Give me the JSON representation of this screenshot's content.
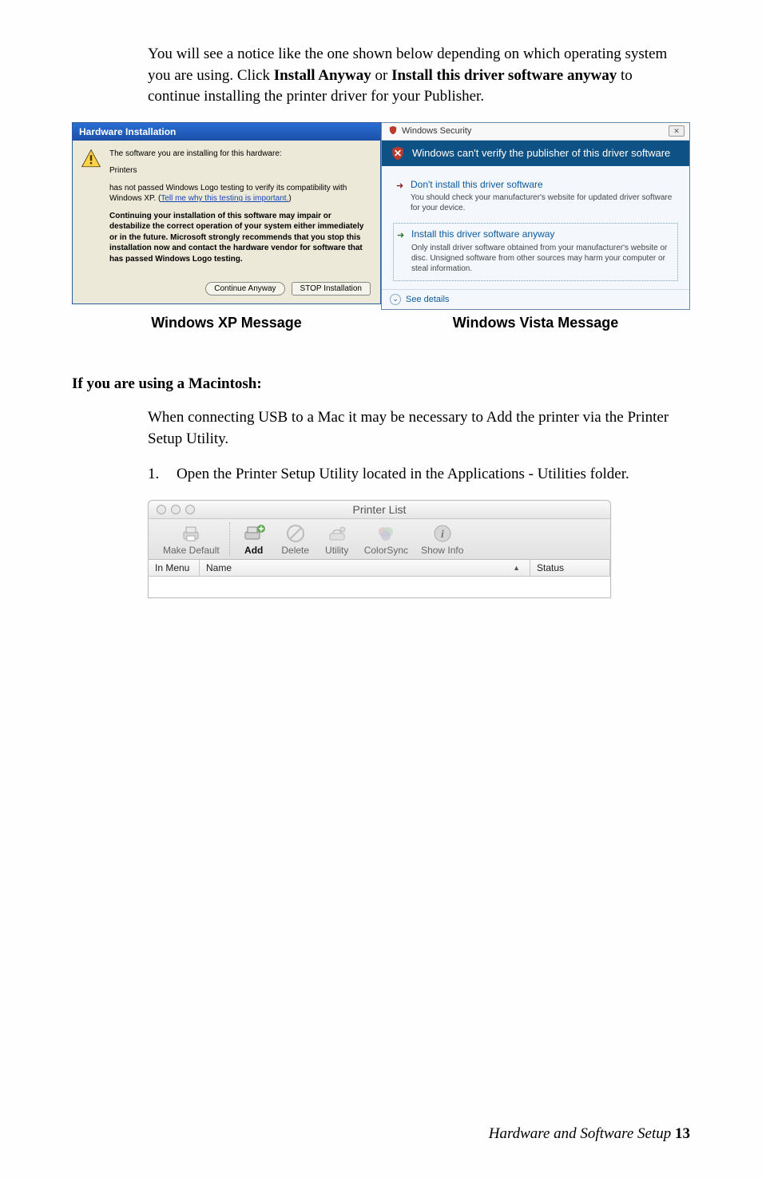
{
  "intro_parts": {
    "p1": "You will see a notice like the one shown below depending on which operating system you are using. Click ",
    "b1": "Install Anyway",
    "p2": " or ",
    "b2": "Install this driver software anyway",
    "p3": " to continue installing the printer driver for your Publisher."
  },
  "xp": {
    "title": "Hardware Installation",
    "line1": "The software you are installing for this hardware:",
    "line2": "Printers",
    "line3a": "has not passed Windows Logo testing to verify its compatibility with Windows XP. (",
    "link": "Tell me why this testing is important.",
    "line3b": ")",
    "bold_para": "Continuing your installation of this software may impair or destabilize the correct operation of your system either immediately or in the future. Microsoft strongly recommends that you stop this installation now and contact the hardware vendor for software that has passed Windows Logo testing.",
    "btn_continue": "Continue Anyway",
    "btn_stop": "STOP Installation"
  },
  "vista": {
    "window_title": "Windows Security",
    "header": "Windows can't verify the publisher of this driver software",
    "opt1_title": "Don't install this driver software",
    "opt1_sub": "You should check your manufacturer's website for updated driver software for your device.",
    "opt2_title": "Install this driver software anyway",
    "opt2_sub": "Only install driver software obtained from your manufacturer's website or disc. Unsigned software from other sources may harm your computer or steal information.",
    "see_details": "See details"
  },
  "captions": {
    "xp": "Windows XP Message",
    "vista": "Windows Vista Message"
  },
  "mac_heading": "If you are using a Macintosh:",
  "mac_intro": "When connecting USB to a Mac it may be necessary to Add the printer via the Printer Setup Utility.",
  "mac_step1": "Open the Printer Setup Utility located in the Applications - Utilities folder.",
  "mac_step1_num": "1.",
  "mac_window": {
    "title": "Printer List",
    "toolbar": {
      "make_default": "Make Default",
      "add": "Add",
      "delete": "Delete",
      "utility": "Utility",
      "colorsync": "ColorSync",
      "show_info": "Show Info"
    },
    "headers": {
      "in_menu": "In Menu",
      "name": "Name",
      "status": "Status"
    }
  },
  "footer": {
    "text": "Hardware and Software Setup",
    "page": "13"
  }
}
